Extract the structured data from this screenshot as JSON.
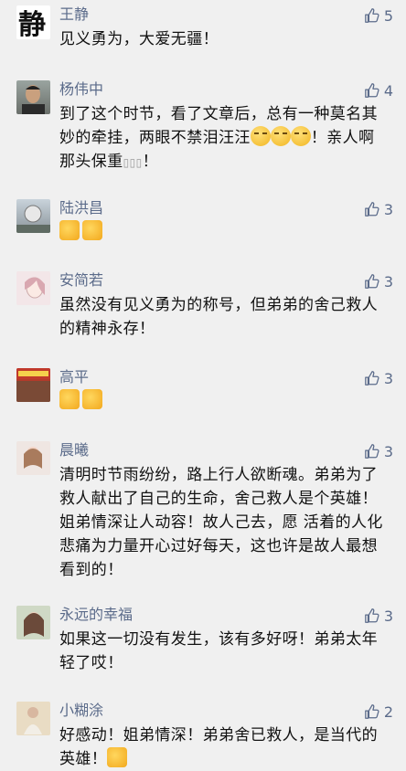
{
  "comments": [
    {
      "name": "王静",
      "likes": "5",
      "text": "见义勇为，大爱无疆！",
      "avatar": "calligraphy-avatar"
    },
    {
      "name": "杨伟中",
      "likes": "4",
      "text": "到了这个时节，看了文章后，总有一种莫名其妙的牵挂，两眼不禁泪汪汪",
      "text2": "！亲人啊那头保重",
      "avatar": "man-portrait-avatar"
    },
    {
      "name": "陆洪昌",
      "likes": "3",
      "text": "",
      "avatar": "landscape-avatar"
    },
    {
      "name": "安简若",
      "likes": "3",
      "text": "虽然没有见义勇为的称号，但弟弟的舍己救人的精神永存！",
      "avatar": "girl-illustration-avatar"
    },
    {
      "name": "高平",
      "likes": "3",
      "text": "",
      "avatar": "shop-sign-avatar"
    },
    {
      "name": "晨曦",
      "likes": "3",
      "text": "清明时节雨纷纷，路上行人欲断魂。弟弟为了救人献出了自己的生命，舍己救人是个英雄！姐弟情深让人动容！故人己去，愿 活着的人化悲痛为力量开心过好每天，这也许是故人最想看到的！",
      "avatar": "portrait-avatar"
    },
    {
      "name": "永远的幸福",
      "likes": "3",
      "text": "如果这一切没有发生，该有多好呀！弟弟太年轻了哎！",
      "avatar": "woman-portrait-avatar"
    },
    {
      "name": "小糊涂",
      "likes": "2",
      "text": "好感动！姐弟情深！弟弟舍已救人，是当代的英雄！",
      "avatar": "figure-avatar"
    }
  ],
  "icons": {
    "like": "thumbs-up-outline-icon",
    "emoji_thumb": "thumbs-up-emoji",
    "emoji_sad": "crying-face-emoji"
  },
  "colors": {
    "name": "#5b6b8a",
    "background": "#f0f0f0",
    "text": "#111111"
  }
}
